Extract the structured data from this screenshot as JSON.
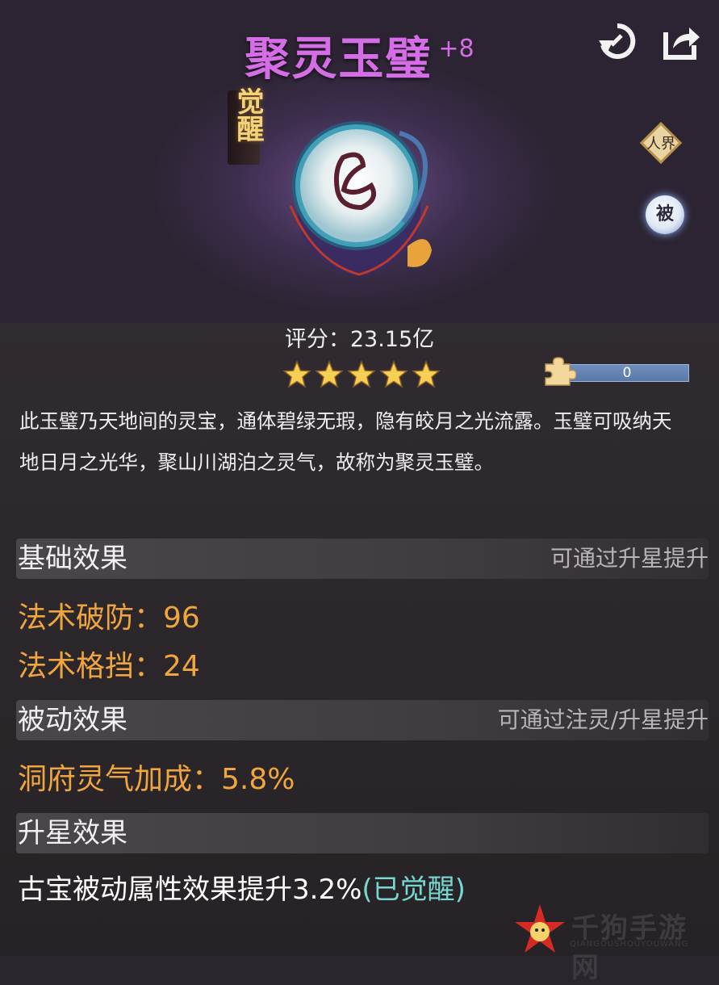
{
  "item": {
    "name": "聚灵玉璧",
    "level": "+8",
    "awaken_tag": "觉醒",
    "realm_badge": "人界",
    "passive_badge": "被",
    "score_label": "评分：",
    "score_value": "23.15亿",
    "stars": 5,
    "fragment_count": "0",
    "fragment_progress": 0,
    "description": "此玉璧乃天地间的灵宝，通体碧绿无瑕，隐有皎月之光流露。玉璧可吸纳天地日月之光华，聚山川湖泊之灵气，故称为聚灵玉璧。",
    "rarity_color": "#d56de6",
    "icons": {
      "back": "return-icon",
      "share": "share-icon",
      "fragment": "puzzle-piece-icon",
      "star": "star-icon"
    }
  },
  "sections": {
    "basic": {
      "title": "基础效果",
      "hint": "可通过升星提升",
      "stats": [
        {
          "label": "法术破防：",
          "value": "96"
        },
        {
          "label": "法术格挡：",
          "value": "24"
        }
      ]
    },
    "passive": {
      "title": "被动效果",
      "hint": "可通过注灵/升星提升",
      "stats": [
        {
          "label": "洞府灵气加成：",
          "value": "5.8%"
        }
      ]
    },
    "star": {
      "title": "升星效果",
      "effect": "古宝被动属性效果提升3.2%",
      "status": "(已觉醒)"
    }
  },
  "watermark": {
    "title": "千狗手游网",
    "subtitle": "QIANGOUSHOUYOUWANG"
  }
}
